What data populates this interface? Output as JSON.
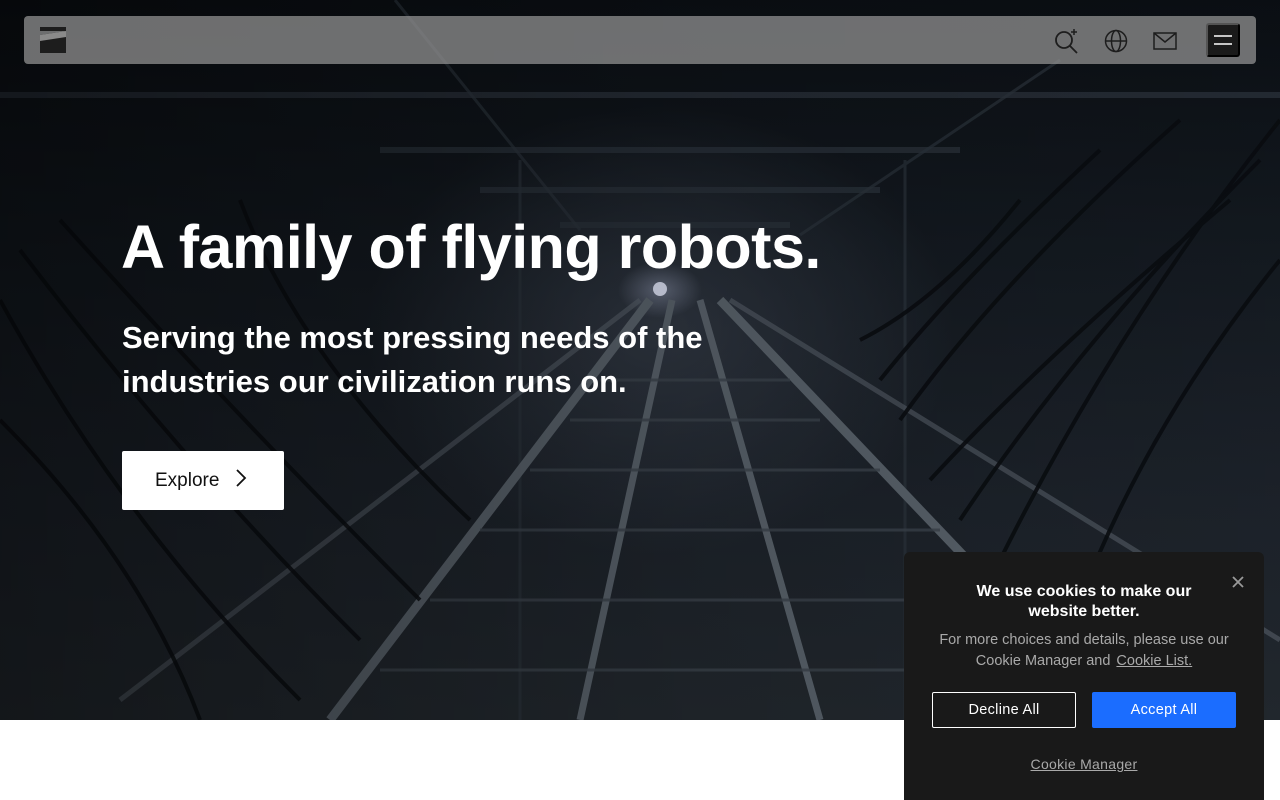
{
  "nav": {
    "logo_icon": "brand-logo",
    "icons": [
      "search-sparkle-icon",
      "globe-icon",
      "mail-icon"
    ],
    "menu_icon": "hamburger-menu-icon"
  },
  "hero": {
    "headline": "A family of flying robots.",
    "subline": "Serving the most pressing needs of the industries our civilization runs on.",
    "cta_label": "Explore",
    "cta_icon": "chevron-right-icon"
  },
  "cookie": {
    "title": "We use cookies to make our website better.",
    "body": "For more choices and details, please use our Cookie Manager and",
    "link": "Cookie List.",
    "decline_label": "Decline All",
    "accept_label": "Accept All",
    "manager_label": "Cookie Manager",
    "accent_color": "#1b6dff"
  }
}
